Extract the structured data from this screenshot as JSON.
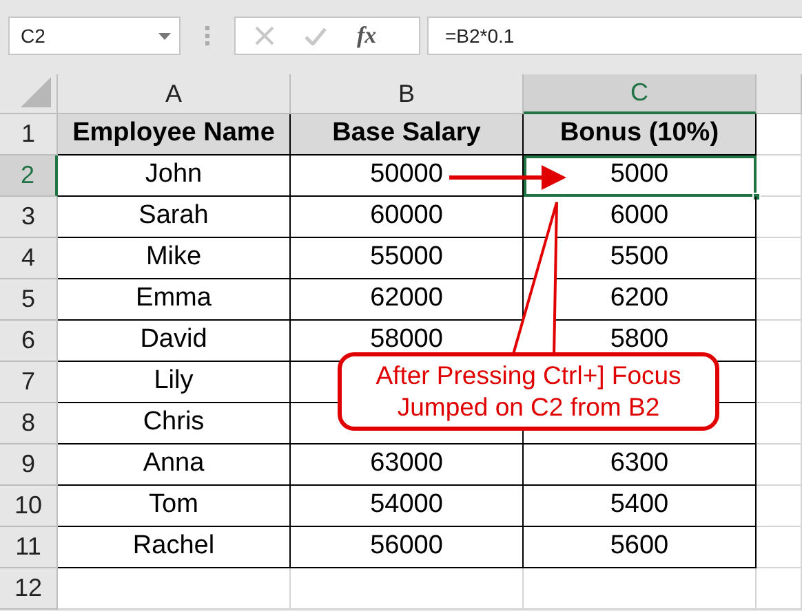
{
  "name_box": {
    "value": "C2"
  },
  "formula_bar": {
    "fx": "fx",
    "formula": "=B2*0.1"
  },
  "columns": [
    {
      "label": "A",
      "selected": false
    },
    {
      "label": "B",
      "selected": false
    },
    {
      "label": "C",
      "selected": true
    }
  ],
  "rows": [
    {
      "number": "1",
      "selected": false,
      "kind": "header",
      "cells": [
        {
          "text": "Employee Name",
          "selected": false
        },
        {
          "text": "Base Salary",
          "selected": false
        },
        {
          "text": "Bonus (10%)",
          "selected": false
        }
      ]
    },
    {
      "number": "2",
      "selected": true,
      "kind": "data",
      "cells": [
        {
          "text": "John",
          "selected": false
        },
        {
          "text": "50000",
          "selected": false
        },
        {
          "text": "5000",
          "selected": true
        }
      ]
    },
    {
      "number": "3",
      "selected": false,
      "kind": "data",
      "cells": [
        {
          "text": "Sarah",
          "selected": false
        },
        {
          "text": "60000",
          "selected": false
        },
        {
          "text": "6000",
          "selected": false
        }
      ]
    },
    {
      "number": "4",
      "selected": false,
      "kind": "data",
      "cells": [
        {
          "text": "Mike",
          "selected": false
        },
        {
          "text": "55000",
          "selected": false
        },
        {
          "text": "5500",
          "selected": false
        }
      ]
    },
    {
      "number": "5",
      "selected": false,
      "kind": "data",
      "cells": [
        {
          "text": "Emma",
          "selected": false
        },
        {
          "text": "62000",
          "selected": false
        },
        {
          "text": "6200",
          "selected": false
        }
      ]
    },
    {
      "number": "6",
      "selected": false,
      "kind": "data",
      "cells": [
        {
          "text": "David",
          "selected": false
        },
        {
          "text": "58000",
          "selected": false
        },
        {
          "text": "5800",
          "selected": false
        }
      ]
    },
    {
      "number": "7",
      "selected": false,
      "kind": "data",
      "cells": [
        {
          "text": "Lily",
          "selected": false
        },
        {
          "selected": false
        },
        {
          "selected": false
        }
      ]
    },
    {
      "number": "8",
      "selected": false,
      "kind": "data",
      "cells": [
        {
          "text": "Chris",
          "selected": false
        },
        {
          "selected": false
        },
        {
          "selected": false
        }
      ]
    },
    {
      "number": "9",
      "selected": false,
      "kind": "data",
      "cells": [
        {
          "text": "Anna",
          "selected": false
        },
        {
          "text": "63000",
          "selected": false
        },
        {
          "text": "6300",
          "selected": false
        }
      ]
    },
    {
      "number": "10",
      "selected": false,
      "kind": "data",
      "cells": [
        {
          "text": "Tom",
          "selected": false
        },
        {
          "text": "54000",
          "selected": false
        },
        {
          "text": "5400",
          "selected": false
        }
      ]
    },
    {
      "number": "11",
      "selected": false,
      "kind": "data",
      "cells": [
        {
          "text": "Rachel",
          "selected": false
        },
        {
          "text": "56000",
          "selected": false
        },
        {
          "text": "5600",
          "selected": false
        }
      ]
    },
    {
      "number": "12",
      "selected": false,
      "kind": "blank"
    }
  ],
  "callout": {
    "lines": [
      "After Pressing Ctrl+] Focus",
      "Jumped on C2 from B2"
    ]
  }
}
